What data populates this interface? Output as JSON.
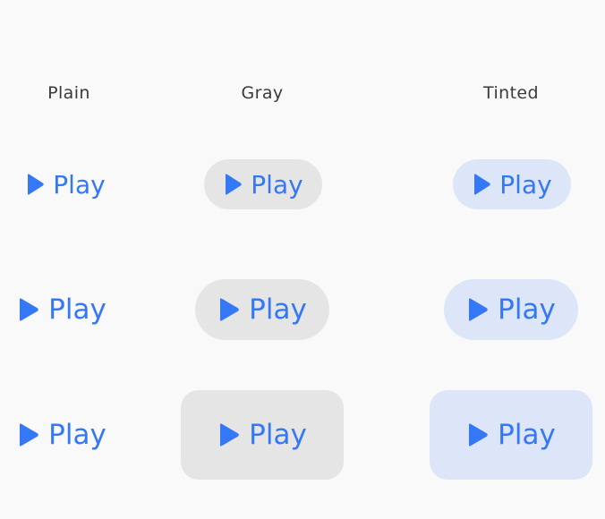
{
  "columns": {
    "plain": "Plain",
    "gray": "Gray",
    "tinted": "Tinted"
  },
  "button": {
    "label": "Play",
    "icon": "play-icon"
  },
  "colors": {
    "accent": "#3478f6",
    "gray_fill": "#e5e5e5",
    "tinted_fill": "#dde6f8",
    "background": "#f9f9f9"
  },
  "rows": {
    "small": {
      "plain": "Play",
      "gray": "Play",
      "tinted": "Play"
    },
    "medium": {
      "plain": "Play",
      "gray": "Play",
      "tinted": "Play"
    },
    "large": {
      "plain": "Play",
      "gray": "Play",
      "tinted": "Play"
    }
  }
}
